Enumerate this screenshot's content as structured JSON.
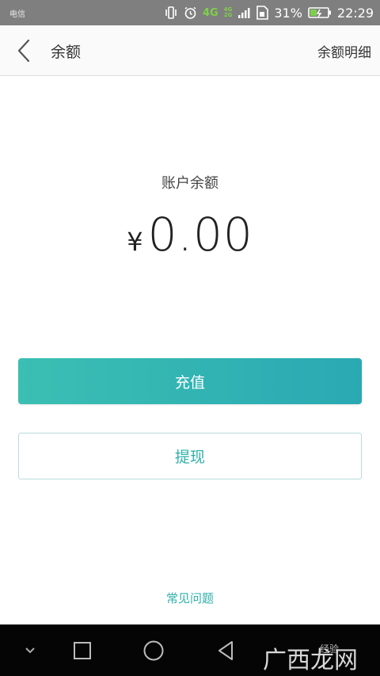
{
  "status_bar": {
    "carrier_label": "电信",
    "network": "4G",
    "network_secondary": "4G",
    "network_tertiary": "2G",
    "battery_percent": "31%",
    "time": "22:29"
  },
  "header": {
    "title": "余额",
    "detail_link": "余额明细"
  },
  "balance": {
    "label": "账户余额",
    "currency": "¥",
    "amount": "0.00"
  },
  "actions": {
    "recharge": "充值",
    "withdraw": "提现"
  },
  "faq": "常见问题",
  "watermark": {
    "text": "广西龙网",
    "small": "经验"
  },
  "icons": {
    "back": "chevron-left-icon",
    "vibrate": "vibrate-icon",
    "alarm": "alarm-icon",
    "signal": "signal-icon",
    "sim": "sim-icon",
    "battery": "battery-charging-icon",
    "nav_collapse": "chevron-down-icon",
    "nav_recent": "square-icon",
    "nav_home": "circle-icon",
    "nav_back": "triangle-back-icon"
  },
  "colors": {
    "accent": "#2fb0a8",
    "button_start": "#3bbfb3",
    "button_end": "#2aa9b3",
    "status_bar": "#7f7f7f",
    "nav_bar": "#050505",
    "network_green": "#7ed04b"
  }
}
